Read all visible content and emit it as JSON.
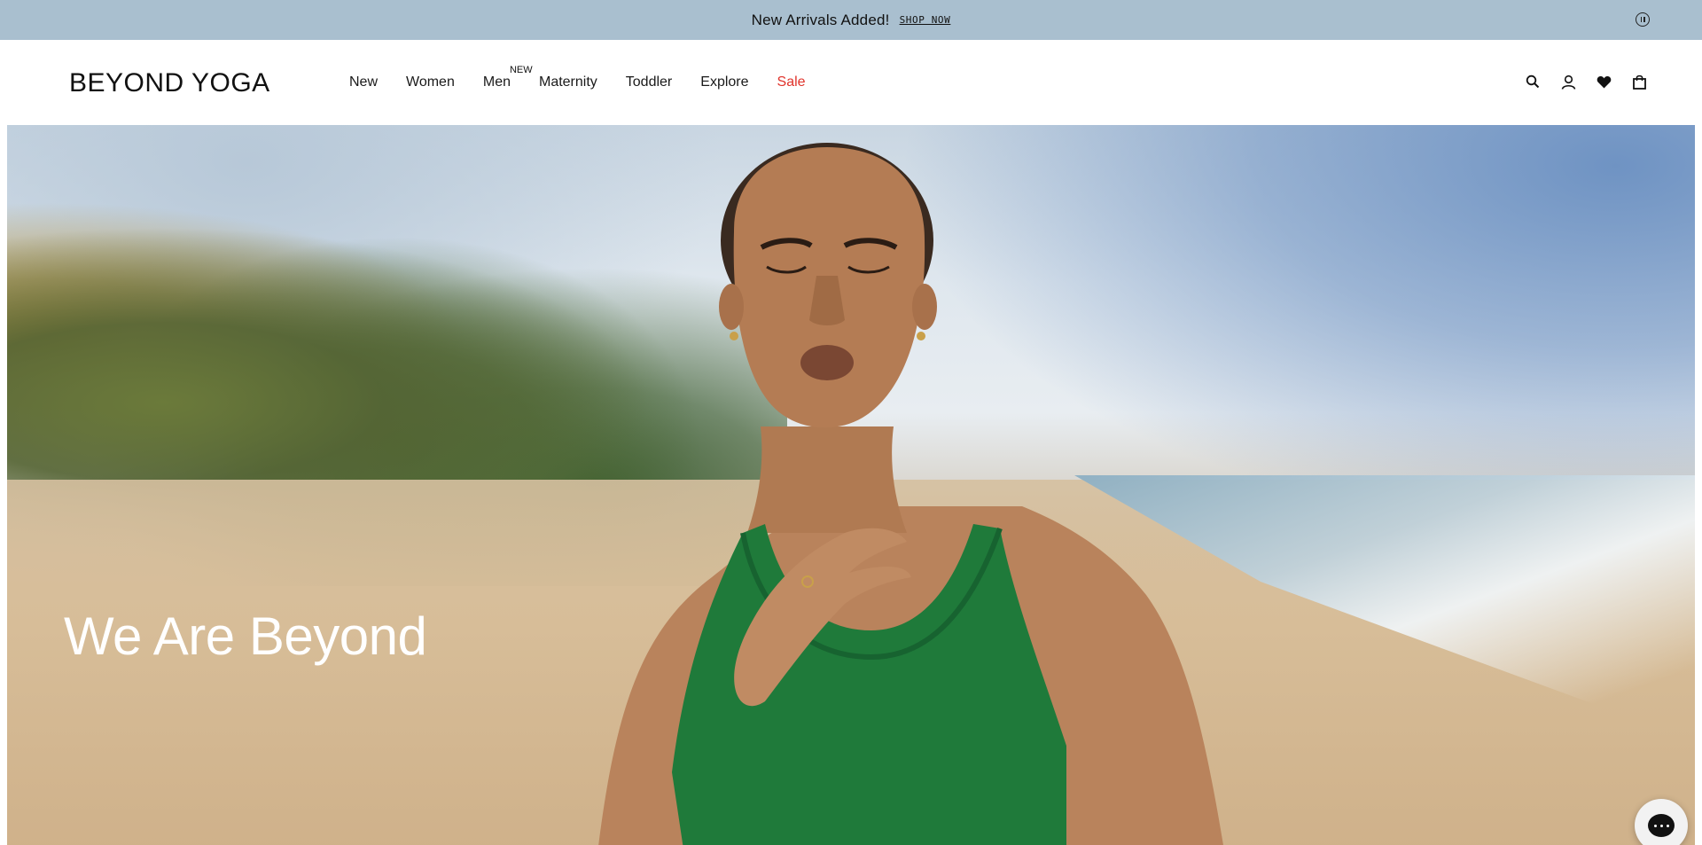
{
  "announcement": {
    "message": "New Arrivals Added!",
    "cta": "SHOP NOW"
  },
  "header": {
    "logo": "BEYOND YOGA",
    "nav": [
      {
        "label": "New"
      },
      {
        "label": "Women"
      },
      {
        "label": "Men",
        "badge": "NEW"
      },
      {
        "label": "Maternity"
      },
      {
        "label": "Toddler"
      },
      {
        "label": "Explore"
      },
      {
        "label": "Sale"
      }
    ],
    "icons": [
      "search-icon",
      "account-icon",
      "heart-icon",
      "bag-icon"
    ]
  },
  "hero": {
    "title": "We Are Beyond"
  },
  "colors": {
    "announcement_bg": "#a9bfcf",
    "sale": "#e0332b",
    "top_green": "#1f7a3a"
  }
}
